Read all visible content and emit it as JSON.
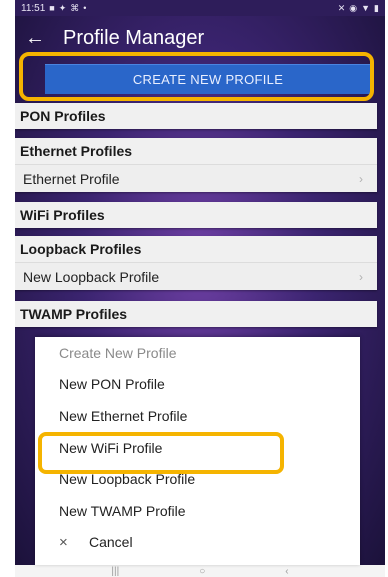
{
  "status_bar": {
    "time": "11:51",
    "left_icons": [
      "■",
      "✦",
      "⌘",
      "•"
    ],
    "right_icons": [
      "✕",
      "◉",
      "▼",
      "▮"
    ]
  },
  "app_bar": {
    "title": "Profile Manager",
    "back_icon": "←"
  },
  "create_button": {
    "label": "CREATE NEW PROFILE"
  },
  "profiles": {
    "pon": {
      "header": "PON Profiles"
    },
    "ethernet": {
      "header": "Ethernet Profiles",
      "item": "Ethernet Profile"
    },
    "wifi": {
      "header": "WiFi Profiles"
    },
    "loopback": {
      "header": "Loopback Profiles",
      "item": "New Loopback Profile"
    },
    "twamp": {
      "header": "TWAMP Profiles"
    }
  },
  "sheet": {
    "title": "Create New Profile",
    "options": [
      "New PON Profile",
      "New Ethernet Profile",
      "New WiFi Profile",
      "New Loopback Profile",
      "New TWAMP Profile"
    ],
    "cancel": "Cancel",
    "cancel_icon": "×"
  },
  "nav_bar": {
    "recent": "|||",
    "home": "○",
    "back": "‹"
  },
  "colors": {
    "accent": "#2a66c9",
    "highlight": "#f5b400",
    "background": "#3b2470"
  }
}
